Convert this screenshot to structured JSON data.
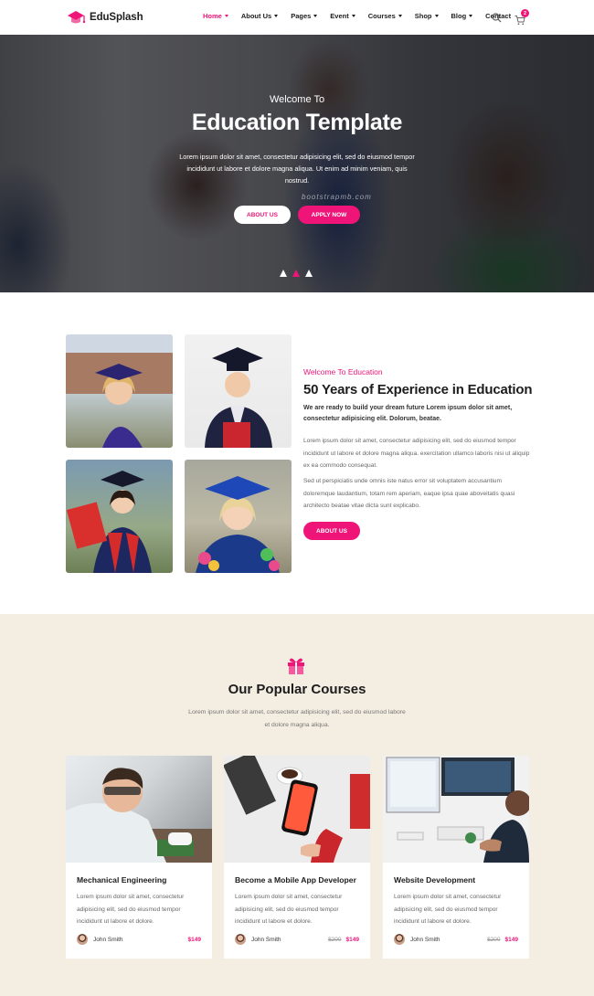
{
  "brand": {
    "name": "EduSplash",
    "accent": "#ee1478"
  },
  "nav": {
    "items": [
      {
        "label": "Home",
        "dropdown": true,
        "active": true
      },
      {
        "label": "About Us",
        "dropdown": true
      },
      {
        "label": "Pages",
        "dropdown": true
      },
      {
        "label": "Event",
        "dropdown": true
      },
      {
        "label": "Courses",
        "dropdown": true
      },
      {
        "label": "Shop",
        "dropdown": true
      },
      {
        "label": "Blog",
        "dropdown": true
      },
      {
        "label": "Contact",
        "dropdown": false
      }
    ],
    "search_icon": "search-icon",
    "cart_icon": "cart-icon",
    "cart_count": "2"
  },
  "hero": {
    "kicker": "Welcome To",
    "title": "Education Template",
    "text": "Lorem ipsum dolor sit amet, consectetur adipisicing elit, sed do eiusmod tempor incididunt ut labore et dolore magna aliqua. Ut enim ad minim veniam, quis nostrud.",
    "watermark": "bootstrapmb.com",
    "buttons": {
      "about": "ABOUT US",
      "apply": "APPLY NOW"
    },
    "slides": 3,
    "active_slide": 2
  },
  "about": {
    "kicker": "Welcome To Education",
    "title": "50 Years of Experience in Education",
    "lead": "We are ready to build your dream future Lorem ipsum dolor sit amet, consectetur adipisicing elit. Dolorum, beatae.",
    "para1": "Lorem ipsum dolor sit amet, consectetur adipisicing elit, sed do eiusmod tempor incididunt ut labore et dolore magna aliqua. exercitation ullamco laboris nisi ut aliquip ex ea commodo consequat.",
    "para2": "Sed ut perspiciatis unde omnis iste natus error sit voluptatem accusantium doloremque laudantium, totam rem aperiam, eaque ipsa quae aboveitatis quasi architecto beatae vitae dicta sunt explicabo.",
    "button": "ABOUT US"
  },
  "courses": {
    "icon": "gift-icon",
    "title": "Our Popular Courses",
    "subtitle": "Lorem ipsum dolor sit amet, consectetur adipisicing elit, sed do eiusmod labore et dolore magna aliqua.",
    "items": [
      {
        "title": "Mechanical Engineering",
        "text": "Lorem ipsum dolor sit amet, consectetur adipisicing elit, sed do eiusmod tempor incididunt ut labore et dolore.",
        "author": "John Smith",
        "old_price": "",
        "price": "$149"
      },
      {
        "title": "Become a Mobile App Developer",
        "text": "Lorem ipsum dolor sit amet, consectetur adipisicing elit, sed do eiusmod tempor incididunt ut labore et dolore.",
        "author": "John Smith",
        "old_price": "$200",
        "price": "$149"
      },
      {
        "title": "Website Development",
        "text": "Lorem ipsum dolor sit amet, consectetur adipisicing elit, sed do eiusmod tempor incididunt ut labore et dolore.",
        "author": "John Smith",
        "old_price": "$200",
        "price": "$149"
      }
    ]
  }
}
